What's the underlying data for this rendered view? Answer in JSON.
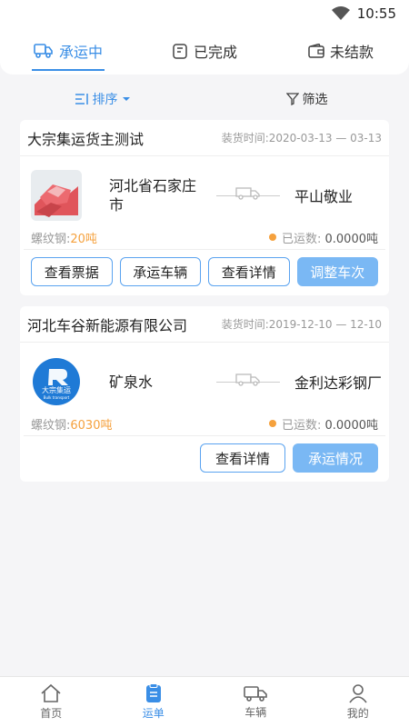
{
  "status": {
    "time": "10:55",
    "icons": [
      "wifi-icon",
      "battery-icon"
    ]
  },
  "tabs": [
    {
      "label": "承运中",
      "icon": "truck-icon",
      "active": true
    },
    {
      "label": "已完成",
      "icon": "clipboard-check-icon",
      "active": false
    },
    {
      "label": "未结款",
      "icon": "wallet-icon",
      "active": false
    }
  ],
  "filters": {
    "sort_label": "排序",
    "filter_label": "筛选"
  },
  "orders": [
    {
      "company": "大宗集运货主测试",
      "load_time": "装货时间:2020-03-13 — 03-13",
      "goods": "河北省石家庄市",
      "destination": "平山敬业",
      "product_label": "螺纹钢:",
      "product_qty": "20吨",
      "shipped_label": "已运数:",
      "shipped_value": "0.0000吨",
      "buttons": [
        "查看票据",
        "承运车辆",
        "查看详情",
        "调整车次"
      ]
    },
    {
      "company": "河北车谷新能源有限公司",
      "load_time": "装货时间:2019-12-10 — 12-10",
      "goods": "矿泉水",
      "destination": "金利达彩钢厂",
      "product_label": "螺纹钢:",
      "product_qty": "6030吨",
      "shipped_label": "已运数:",
      "shipped_value": "0.0000吨",
      "logo_text": "大宗集运",
      "logo_subtext": "Bulk transport",
      "buttons": [
        "查看详情",
        "承运情况"
      ]
    }
  ],
  "nav": [
    {
      "label": "首页",
      "icon": "home-icon",
      "active": false
    },
    {
      "label": "运单",
      "icon": "waybill-icon",
      "active": true
    },
    {
      "label": "车辆",
      "icon": "truck-icon",
      "active": false
    },
    {
      "label": "我的",
      "icon": "user-icon",
      "active": false
    }
  ],
  "colors": {
    "accent": "#3a8ee6",
    "orange": "#f5a13d",
    "primary_button": "#7ab8f4"
  }
}
